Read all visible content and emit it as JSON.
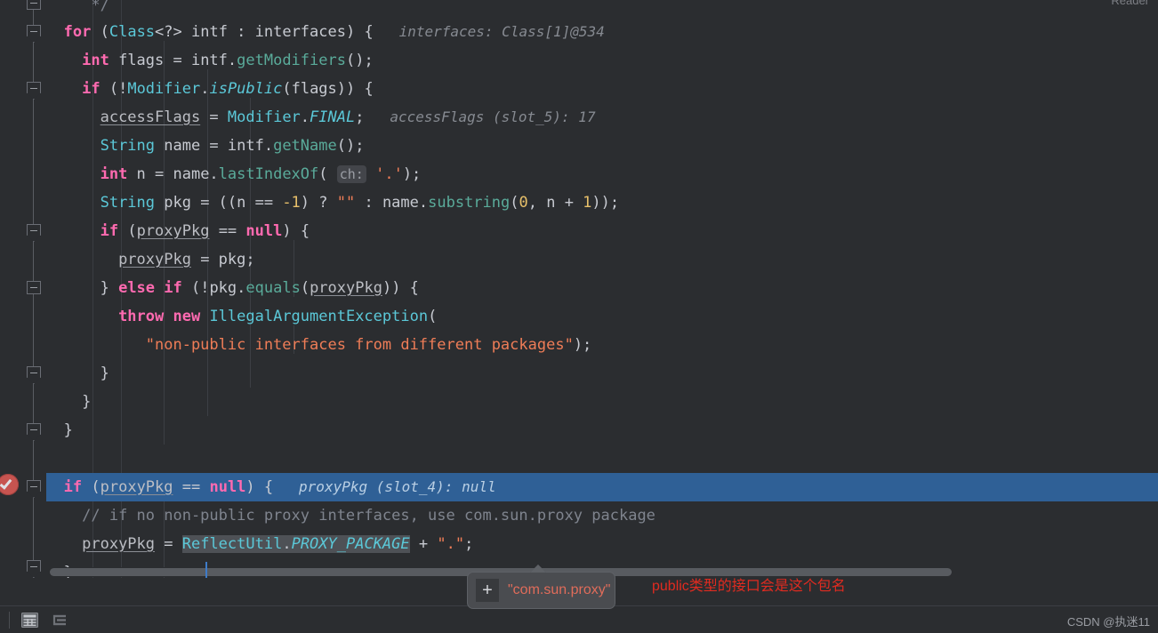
{
  "editor": {
    "reader_label": "Reader",
    "lines": [
      {
        "indent": 0,
        "text": "*/",
        "type": "comment-end"
      },
      {
        "indent": 0,
        "text": "for (Class<?> intf : interfaces) {",
        "hint": "interfaces: Class[1]@534"
      },
      {
        "indent": 1,
        "text": "int flags = intf.getModifiers();",
        "hint": ""
      },
      {
        "indent": 1,
        "text": "if (!Modifier.isPublic(flags)) {",
        "hint": ""
      },
      {
        "indent": 2,
        "text": "accessFlags = Modifier.FINAL;",
        "hint": "accessFlags (slot_5): 17"
      },
      {
        "indent": 2,
        "text": "String name = intf.getName();",
        "hint": ""
      },
      {
        "indent": 2,
        "text": "int n = name.lastIndexOf( ch: '.');",
        "hint": ""
      },
      {
        "indent": 2,
        "text": "String pkg = ((n == -1) ? \"\" : name.substring(0, n + 1));",
        "hint": ""
      },
      {
        "indent": 2,
        "text": "if (proxyPkg == null) {",
        "hint": ""
      },
      {
        "indent": 3,
        "text": "proxyPkg = pkg;",
        "hint": ""
      },
      {
        "indent": 2,
        "text": "} else if (!pkg.equals(proxyPkg)) {",
        "hint": ""
      },
      {
        "indent": 3,
        "text": "throw new IllegalArgumentException(",
        "hint": ""
      },
      {
        "indent": 4,
        "text": "\"non-public interfaces from different packages\");",
        "hint": ""
      },
      {
        "indent": 2,
        "text": "}",
        "hint": ""
      },
      {
        "indent": 1,
        "text": "}",
        "hint": ""
      },
      {
        "indent": 0,
        "text": "}",
        "hint": ""
      },
      {
        "indent": 0,
        "text": "",
        "hint": ""
      },
      {
        "indent": 0,
        "text": "if (proxyPkg == null) {",
        "hint": "proxyPkg (slot_4): null",
        "executing": true
      },
      {
        "indent": 1,
        "text": "// if no non-public proxy interfaces, use com.sun.proxy package",
        "hint": ""
      },
      {
        "indent": 1,
        "text": "proxyPkg = ReflectUtil.PROXY_PACKAGE + \".\";",
        "hint": ""
      },
      {
        "indent": 0,
        "text": "}",
        "hint": ""
      }
    ],
    "inline_hints": {
      "interfaces_value": "interfaces: Class[1]@534",
      "accessFlags_value": "accessFlags (slot_5): 17",
      "proxyPkg_value": "proxyPkg (slot_4): null"
    },
    "param_hint_label": "ch:",
    "highlighted_identifier": "ReflectUtil.PROXY_PACKAGE",
    "breakpoint_icon": "verified-breakpoint-icon"
  },
  "tooltip": {
    "add_icon": "plus-icon",
    "value": "\"com.sun.proxy\""
  },
  "annotation": {
    "text": "public类型的接口会是这个包名",
    "color": "#e02b20"
  },
  "bottom_bar": {
    "icons": [
      {
        "name": "table-view-icon",
        "label": "Table View",
        "active": true
      },
      {
        "name": "list-view-icon",
        "label": "List View",
        "active": false
      }
    ],
    "watermark": "CSDN @执迷11"
  },
  "colors": {
    "background": "#2b2d30",
    "executing_line": "#2f6096",
    "keyword": "#ff6ab0",
    "class_name": "#5bc8d8",
    "method": "#5aab9a",
    "number": "#e8c06a",
    "string": "#ef7d57",
    "comment": "#7f848e",
    "breakpoint": "#c75450",
    "annotation": "#e02b20"
  }
}
